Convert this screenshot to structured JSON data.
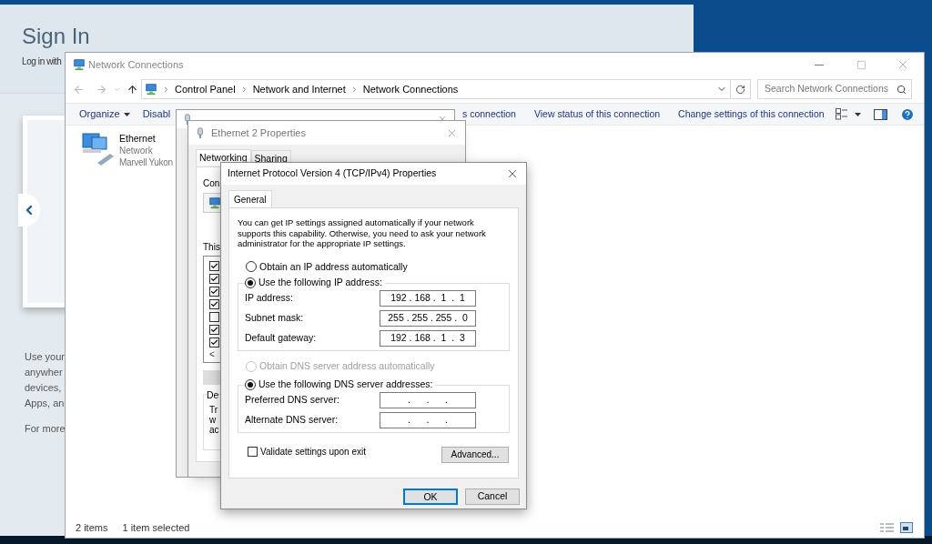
{
  "signin_page": {
    "title": "Sign In",
    "subtitle": "Log in with",
    "body_lines": [
      "Use your",
      "anywher",
      "devices,",
      "Apps, an"
    ],
    "footer": "For more"
  },
  "network_window": {
    "title": "Network Connections",
    "breadcrumb": [
      "Control Panel",
      "Network and Internet",
      "Network Connections"
    ],
    "search": {
      "placeholder": "Search Network Connections"
    },
    "toolbar_left": [
      {
        "label": "Organize",
        "kind": "menu"
      },
      {
        "label": "Disabl",
        "kind": "command"
      }
    ],
    "toolbar_right": [
      "s connection",
      "View status of this connection",
      "Change settings of this connection"
    ],
    "items": [
      {
        "name": "Ethernet",
        "status": "Network",
        "device": "Marvell Yukon",
        "selected": false
      }
    ],
    "status_bar": [
      "2 items",
      "1 item selected"
    ]
  },
  "properties_dialog": {
    "title": "Ethernet 2 Properties",
    "tabs": [
      {
        "label": "Networking",
        "selected": true
      },
      {
        "label": "Sharing",
        "selected": false
      }
    ],
    "connect_label": "Con",
    "list_label": "This",
    "components": [
      {
        "checked": true
      },
      {
        "checked": true
      },
      {
        "checked": true
      },
      {
        "checked": true
      },
      {
        "checked": false
      },
      {
        "checked": true
      },
      {
        "checked": true
      }
    ],
    "scroll_button": "<",
    "group_label": "De",
    "description_lines": [
      "Tr",
      "w",
      "ac"
    ]
  },
  "ipv4_dialog": {
    "title": "Internet Protocol Version 4 (TCP/IPv4) Properties",
    "tabs": [
      {
        "label": "General",
        "selected": true
      }
    ],
    "description": "You can get IP settings assigned automatically if your network supports this capability. Otherwise, you need to ask your network administrator for the appropriate IP settings.",
    "ip_mode": [
      {
        "label": "Obtain an IP address automatically",
        "selected": false,
        "disabled": false
      },
      {
        "label": "Use the following IP address:",
        "selected": true,
        "disabled": false
      }
    ],
    "ip_fields": [
      {
        "label": "IP address:",
        "value": "192 . 168 .  1  .  1"
      },
      {
        "label": "Subnet mask:",
        "value": "255 . 255 . 255 .  0"
      },
      {
        "label": "Default gateway:",
        "value": "192 . 168 .  1  .  3"
      }
    ],
    "dns_mode": [
      {
        "label": "Obtain DNS server address automatically",
        "selected": false,
        "disabled": true
      },
      {
        "label": "Use the following DNS server addresses:",
        "selected": true,
        "disabled": false
      }
    ],
    "dns_fields": [
      {
        "label": "Preferred DNS server:",
        "value": ".      .      ."
      },
      {
        "label": "Alternate DNS server:",
        "value": ".      .      ."
      }
    ],
    "validate": {
      "label": "Validate settings upon exit",
      "checked": false
    },
    "advanced_button": "Advanced...",
    "buttons": [
      {
        "label": "OK",
        "default": true
      },
      {
        "label": "Cancel",
        "default": false
      }
    ]
  }
}
